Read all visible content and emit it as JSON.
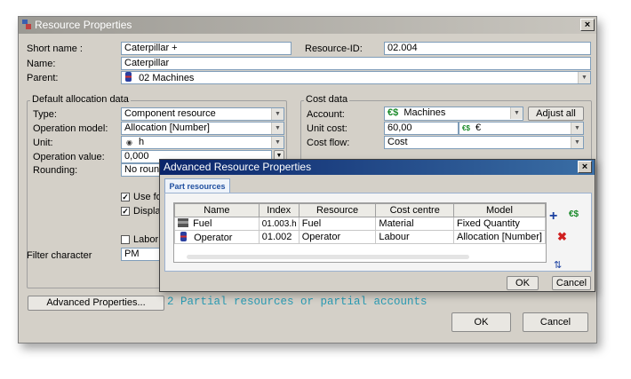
{
  "window": {
    "title": "Resource Properties",
    "close": "×"
  },
  "top": {
    "short_name_label": "Short name :",
    "short_name_value": "Caterpillar +",
    "resource_id_label": "Resource-ID:",
    "resource_id_value": "02.004",
    "name_label": "Name:",
    "name_value": "Caterpillar",
    "parent_label": "Parent:",
    "parent_value": "02 Machines"
  },
  "alloc": {
    "title": "Default allocation data",
    "type_label": "Type:",
    "type_value": "Component resource",
    "opmodel_label": "Operation model:",
    "opmodel_value": "Allocation [Number]",
    "unit_label": "Unit:",
    "unit_value": "h",
    "opvalue_label": "Operation value:",
    "opvalue_value": "0,000",
    "rounding_label": "Rounding:",
    "rounding_value": "No roundi",
    "use_for_label": "Use for",
    "display_label": "Display",
    "labor_label": "Labor r",
    "filter_label": "Filter character",
    "filter_value": "PM"
  },
  "cost": {
    "title": "Cost data",
    "account_label": "Account:",
    "account_value": "Machines",
    "adjust_all": "Adjust all",
    "unitcost_label": "Unit cost:",
    "unitcost_value": "60,00",
    "currency_value": "€",
    "costflow_label": "Cost flow:",
    "costflow_value": "Cost"
  },
  "bottom": {
    "advanced_button": "Advanced Properties...",
    "status_text": "2 Partial resources or partial accounts",
    "ok": "OK",
    "cancel": "Cancel"
  },
  "dialog": {
    "title": "Advanced Resource Properties",
    "close": "×",
    "tab": "Part resources",
    "columns": [
      "Name",
      "Index",
      "Resource",
      "Cost centre",
      "Model"
    ],
    "rows": [
      [
        "Fuel",
        "01.003.h",
        "Fuel",
        "Material",
        "Fixed Quantity"
      ],
      [
        "Operator",
        "01.002",
        "Operator",
        "Labour",
        "Allocation [Number]"
      ]
    ],
    "ok": "OK",
    "cancel": "Cancel"
  },
  "colors": {
    "dialog_title": "#0a246a",
    "status_text": "#2a9bb3",
    "window_bg": "#d4d0c8"
  }
}
